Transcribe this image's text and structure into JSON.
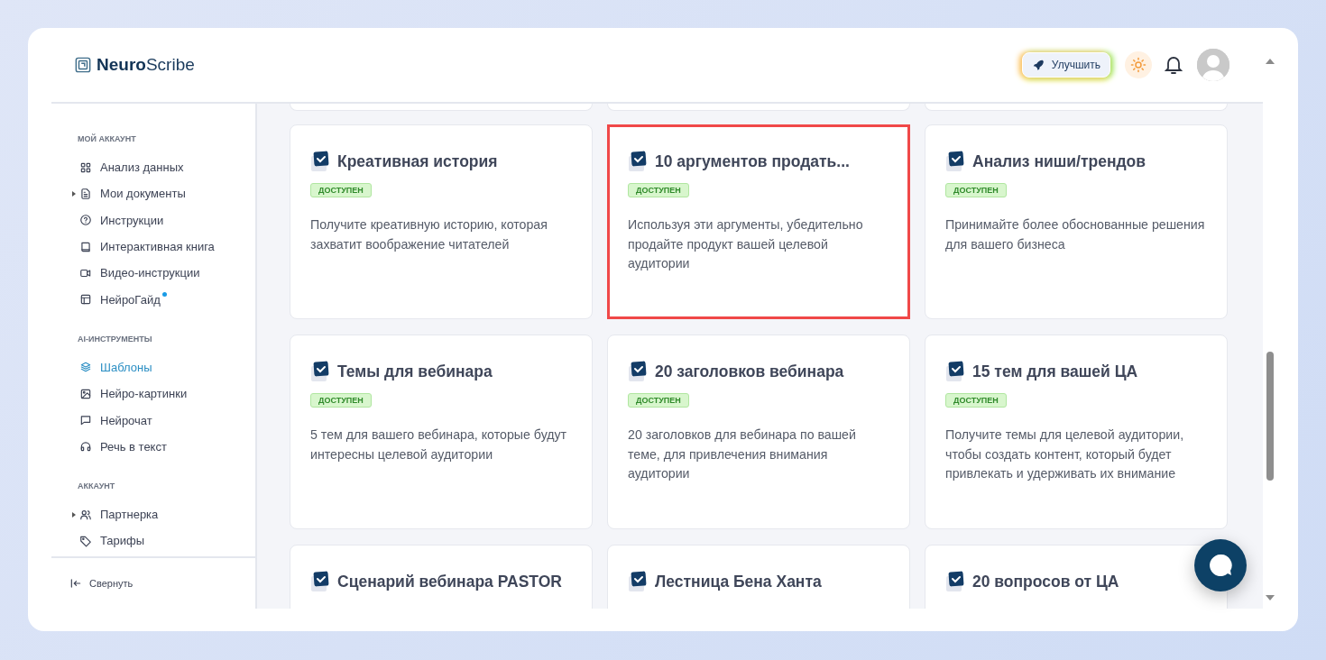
{
  "header": {
    "logo": "**Neuro**Scribe",
    "upgrade_button": "Улучшить"
  },
  "sidebar": {
    "sections": [
      {
        "title": "МОЙ АККАУНТ",
        "items": [
          {
            "label": "Анализ данных",
            "selected": false,
            "expandable": false,
            "new_dot": false
          },
          {
            "label": "Мои документы",
            "selected": false,
            "expandable": true,
            "new_dot": false
          },
          {
            "label": "Инструкции",
            "selected": false,
            "expandable": false,
            "new_dot": false
          },
          {
            "label": "Интерактивная книга",
            "selected": false,
            "expandable": false,
            "new_dot": false
          },
          {
            "label": "Видео-инструкции",
            "selected": false,
            "expandable": false,
            "new_dot": false
          },
          {
            "label": "НейроГайд",
            "selected": false,
            "expandable": false,
            "new_dot": true
          }
        ]
      },
      {
        "title": "AI-ИНСТРУМЕНТЫ",
        "items": [
          {
            "label": "Шаблоны",
            "selected": true,
            "expandable": false,
            "new_dot": false
          },
          {
            "label": "Нейро-картинки",
            "selected": false,
            "expandable": false,
            "new_dot": false
          },
          {
            "label": "Нейрочат",
            "selected": false,
            "expandable": false,
            "new_dot": false
          },
          {
            "label": "Речь в текст",
            "selected": false,
            "expandable": false,
            "new_dot": false
          }
        ]
      },
      {
        "title": "АККАУНТ",
        "items": [
          {
            "label": "Партнерка",
            "selected": false,
            "expandable": true,
            "new_dot": false
          },
          {
            "label": "Тарифы",
            "selected": false,
            "expandable": false,
            "new_dot": false
          }
        ]
      }
    ],
    "collapse": "Свернуть"
  },
  "cards": [
    {
      "title": "Креативная история",
      "badge": "ДОСТУПЕН",
      "description": "Получите креативную историю, которая захватит воображение читателей",
      "selected": false
    },
    {
      "title": "10 аргументов продать...",
      "badge": "ДОСТУПЕН",
      "description": "Используя эти аргументы, убедительно продайте продукт вашей целевой аудитории",
      "selected": true
    },
    {
      "title": "Анализ ниши/трендов",
      "badge": "ДОСТУПЕН",
      "description": "Принимайте более обоснованные решения для вашего бизнеса",
      "selected": false
    },
    {
      "title": "Темы для вебинара",
      "badge": "ДОСТУПЕН",
      "description": "5 тем для вашего вебинара, которые будут интересны целевой аудитории",
      "selected": false
    },
    {
      "title": "20 заголовков вебинара",
      "badge": "ДОСТУПЕН",
      "description": "20 заголовков для вебинара по вашей теме, для привлечения внимания аудитории",
      "selected": false
    },
    {
      "title": "15 тем для вашей ЦА",
      "badge": "ДОСТУПЕН",
      "description": "Получите темы для целевой аудитории, чтобы создать контент, который будет привлекать и удерживать их внимание",
      "selected": false
    },
    {
      "title": "Сценарий вебинара PASTOR",
      "selected": false
    },
    {
      "title": "Лестница Бена Ханта",
      "selected": false
    },
    {
      "title": "20 вопросов от ЦА",
      "selected": false
    }
  ]
}
